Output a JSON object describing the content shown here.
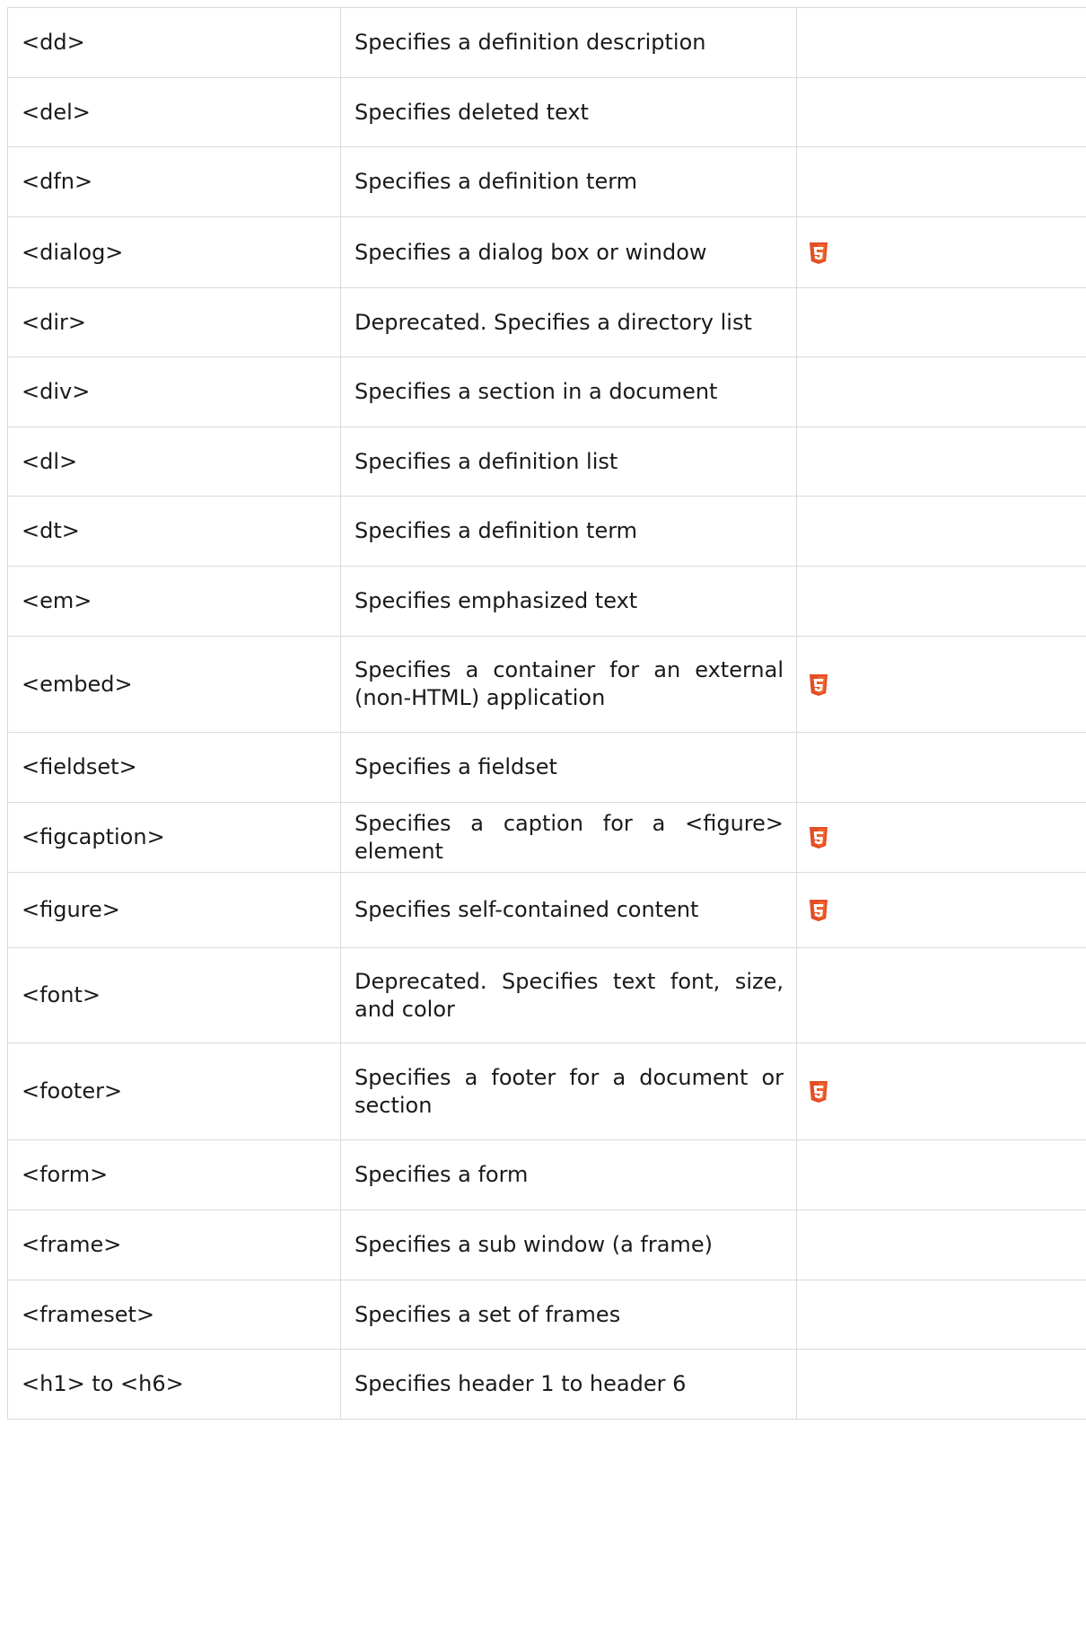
{
  "rows": [
    {
      "tag": "<dd>",
      "description": "Specifies a definition description",
      "html5": false
    },
    {
      "tag": "<del>",
      "description": "Specifies deleted text",
      "html5": false
    },
    {
      "tag": "<dfn>",
      "description": "Specifies a definition term",
      "html5": false
    },
    {
      "tag": "<dialog>",
      "description": "Specifies a dialog box or window",
      "html5": true
    },
    {
      "tag": "<dir>",
      "description": "Deprecated. Specifies a directory list",
      "html5": false
    },
    {
      "tag": "<div>",
      "description": "Specifies a section in a document",
      "html5": false
    },
    {
      "tag": "<dl>",
      "description": "Specifies a definition list",
      "html5": false
    },
    {
      "tag": "<dt>",
      "description": "Specifies a definition term",
      "html5": false
    },
    {
      "tag": "<em>",
      "description": "Specifies emphasized text",
      "html5": false
    },
    {
      "tag": "<embed>",
      "description": "Specifies a container for an external (non-HTML) application",
      "html5": true
    },
    {
      "tag": "<fieldset>",
      "description": "Specifies a fieldset",
      "html5": false
    },
    {
      "tag": "<figcaption>",
      "description": "Specifies a caption for a <figure> element",
      "html5": true
    },
    {
      "tag": "<figure>",
      "description": "Specifies self-contained content",
      "html5": true
    },
    {
      "tag": "<font>",
      "description": "Deprecated. Specifies text font, size, and color",
      "html5": false
    },
    {
      "tag": "<footer>",
      "description": "Specifies a footer for a document or section",
      "html5": true
    },
    {
      "tag": "<form>",
      "description": "Specifies a form",
      "html5": false
    },
    {
      "tag": "<frame>",
      "description": "Specifies a sub window (a frame)",
      "html5": false
    },
    {
      "tag": "<frameset>",
      "description": "Specifies a set of frames",
      "html5": false
    },
    {
      "tag": "<h1> to <h6>",
      "description": "Specifies header 1 to header 6",
      "html5": false
    }
  ],
  "icons": {
    "html5": "html5-logo-icon"
  },
  "colors": {
    "html5_orange": "#e44d26",
    "html5_orange_light": "#f16529",
    "border": "#d9d9d9"
  }
}
